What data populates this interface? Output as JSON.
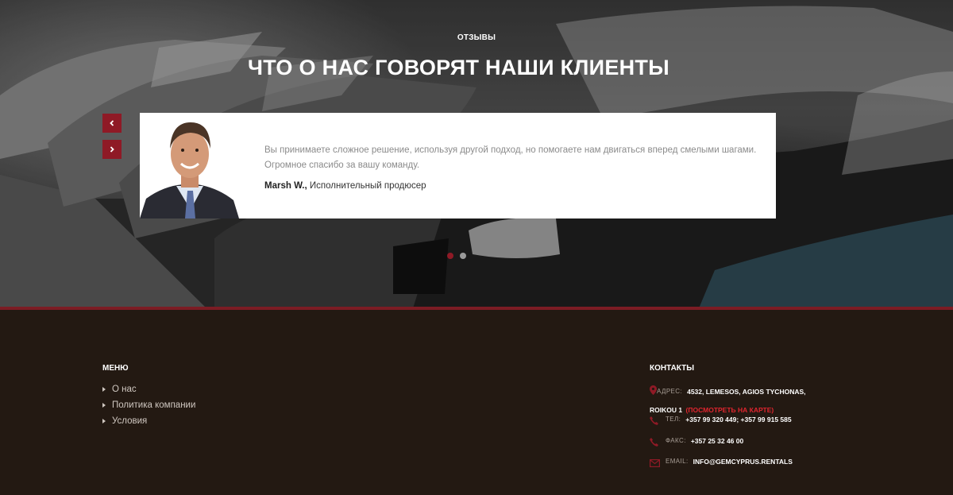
{
  "hero": {
    "eyebrow": "ОТЗЫВЫ",
    "title": "ЧТО О НАС ГОВОРЯТ НАШИ КЛИЕНТЫ"
  },
  "testimonial": {
    "quote": "Вы принимаете сложное решение, используя другой подход, но помогаете нам двигаться вперед смелыми шагами. Огромное спасибо за вашу команду.",
    "author_name": "Marsh W.,",
    "author_role": "Исполнительный продюсер",
    "prev_icon": "chevron-left-icon",
    "next_icon": "chevron-right-icon",
    "slides_total": 2,
    "slide_active": 1
  },
  "footer": {
    "menu": {
      "heading": "МЕНЮ",
      "items": [
        {
          "label": "О нас"
        },
        {
          "label": "Политика компании"
        },
        {
          "label": "Условия"
        }
      ]
    },
    "contacts": {
      "heading": "КОНТАКТЫ",
      "address_label": "АДРЕС:",
      "address_line1": "4532, LEMESOS, AGIOS TYCHONAS,",
      "address_line2": "ROIKOU 1",
      "map_link": "(ПОСМОТРЕТЬ НА КАРТЕ)",
      "phone_label": "ТЕЛ:",
      "phone_value": "+357 99 320 449; +357 99 915 585",
      "fax_label": "ФАКС:",
      "fax_value": "+357 25 32 46 00",
      "email_label": "EMAIL:",
      "email_value": "INFO@GEMCYPRUS.RENTALS"
    }
  },
  "colors": {
    "accent": "#8f1a26",
    "link_red": "#e0252f",
    "footer_bg": "#231912"
  }
}
